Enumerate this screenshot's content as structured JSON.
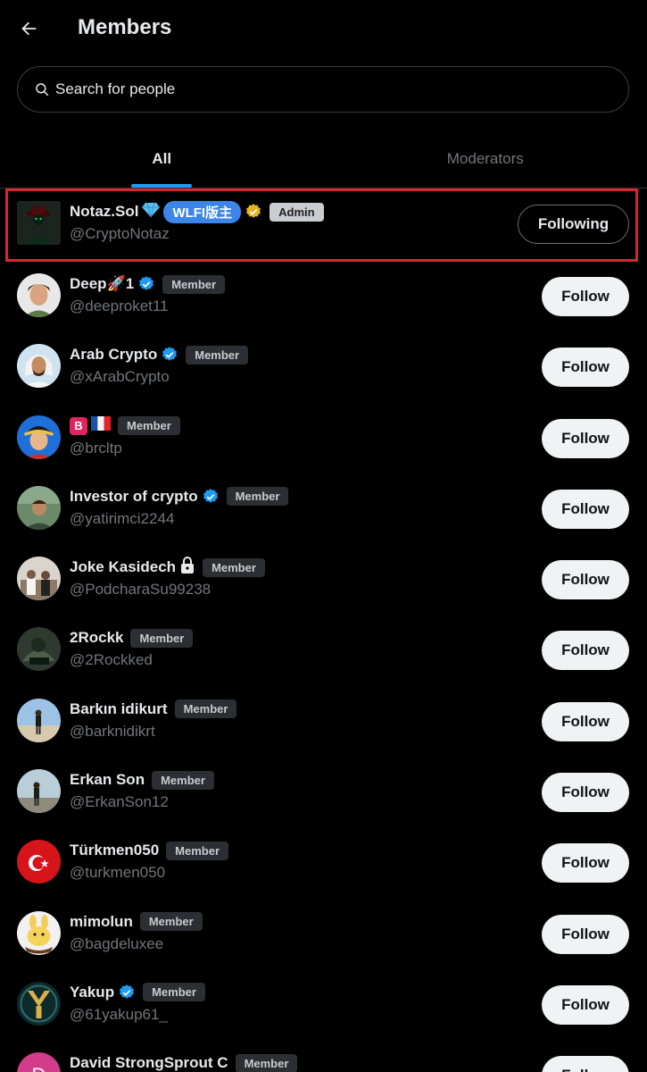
{
  "header": {
    "title": "Members",
    "back_icon": "arrow-left-icon"
  },
  "search": {
    "placeholder": "Search for people"
  },
  "tabs": [
    {
      "label": "All",
      "active": true
    },
    {
      "label": "Moderators",
      "active": false
    }
  ],
  "colors": {
    "accent": "#1d9bf0",
    "verified": "#1d9bf0",
    "gold_verified": "#e8b323",
    "highlight": "#e0222b",
    "background": "#000000"
  },
  "members": [
    {
      "name": "Notaz.Sol",
      "handle": "@CryptoNotaz",
      "tag": "WLFI版主",
      "role": "Admin",
      "button": "Following",
      "verified": "gold"
    },
    {
      "name": "Deep🚀1",
      "handle": "@deeproket11",
      "role": "Member",
      "button": "Follow",
      "verified": "blue"
    },
    {
      "name": "Arab Crypto",
      "handle": "@xArabCrypto",
      "role": "Member",
      "button": "Follow",
      "verified": "blue"
    },
    {
      "name": "🇧🇫🇷",
      "handle": "@brcltp",
      "role": "Member",
      "button": "Follow",
      "verified": "none"
    },
    {
      "name": "Investor of crypto",
      "handle": "@yatirimci2244",
      "role": "Member",
      "button": "Follow",
      "verified": "blue"
    },
    {
      "name": "Joke Kasidech",
      "handle": "@PodcharaSu99238",
      "role": "Member",
      "button": "Follow",
      "verified": "lock"
    },
    {
      "name": "2Rockk",
      "handle": "@2Rockked",
      "role": "Member",
      "button": "Follow",
      "verified": "none"
    },
    {
      "name": "Barkın idikurt",
      "handle": "@barknidikrt",
      "role": "Member",
      "button": "Follow",
      "verified": "none"
    },
    {
      "name": "Erkan Son",
      "handle": "@ErkanSon12",
      "role": "Member",
      "button": "Follow",
      "verified": "none"
    },
    {
      "name": "Türkmen050",
      "handle": "@turkmen050",
      "role": "Member",
      "button": "Follow",
      "verified": "none"
    },
    {
      "name": "mimolun",
      "handle": "@bagdeluxee",
      "role": "Member",
      "button": "Follow",
      "verified": "none"
    },
    {
      "name": "Yakup",
      "handle": "@61yakup61_",
      "role": "Member",
      "button": "Follow",
      "verified": "blue"
    },
    {
      "name": "David StrongSprout C",
      "handle": "",
      "role": "Member",
      "button": "Follow",
      "verified": "none"
    }
  ]
}
